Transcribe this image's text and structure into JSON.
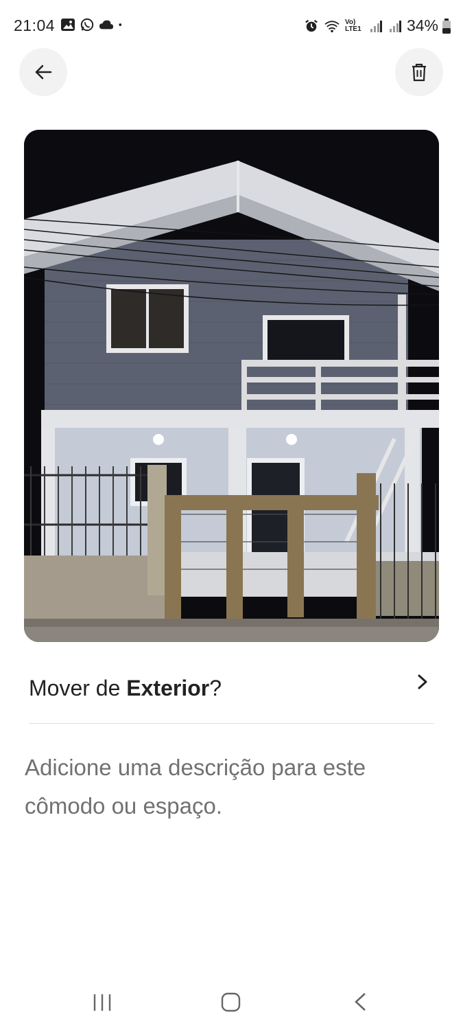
{
  "status_bar": {
    "time": "21:04",
    "left_icons": [
      "gallery-icon",
      "whatsapp-icon",
      "cloud-icon",
      "dot-icon"
    ],
    "right_icons": [
      "alarm-icon",
      "wifi-icon",
      "volte-icon",
      "signal-icon",
      "signal-icon",
      "battery-icon"
    ],
    "volte_text": "Vo) LTE1",
    "battery_percent": "34%"
  },
  "header": {
    "back_icon": "arrow-left-icon",
    "delete_icon": "trash-icon"
  },
  "photo": {
    "subject": "house-exterior-photo"
  },
  "move": {
    "prefix": "Mover de ",
    "room": "Exterior",
    "suffix": "?",
    "chevron_icon": "chevron-right-icon"
  },
  "description": {
    "placeholder": "Adicione uma descrição para este cômodo ou espaço."
  },
  "nav_bar": {
    "icons": [
      "recents-icon",
      "home-icon",
      "back-icon"
    ]
  }
}
